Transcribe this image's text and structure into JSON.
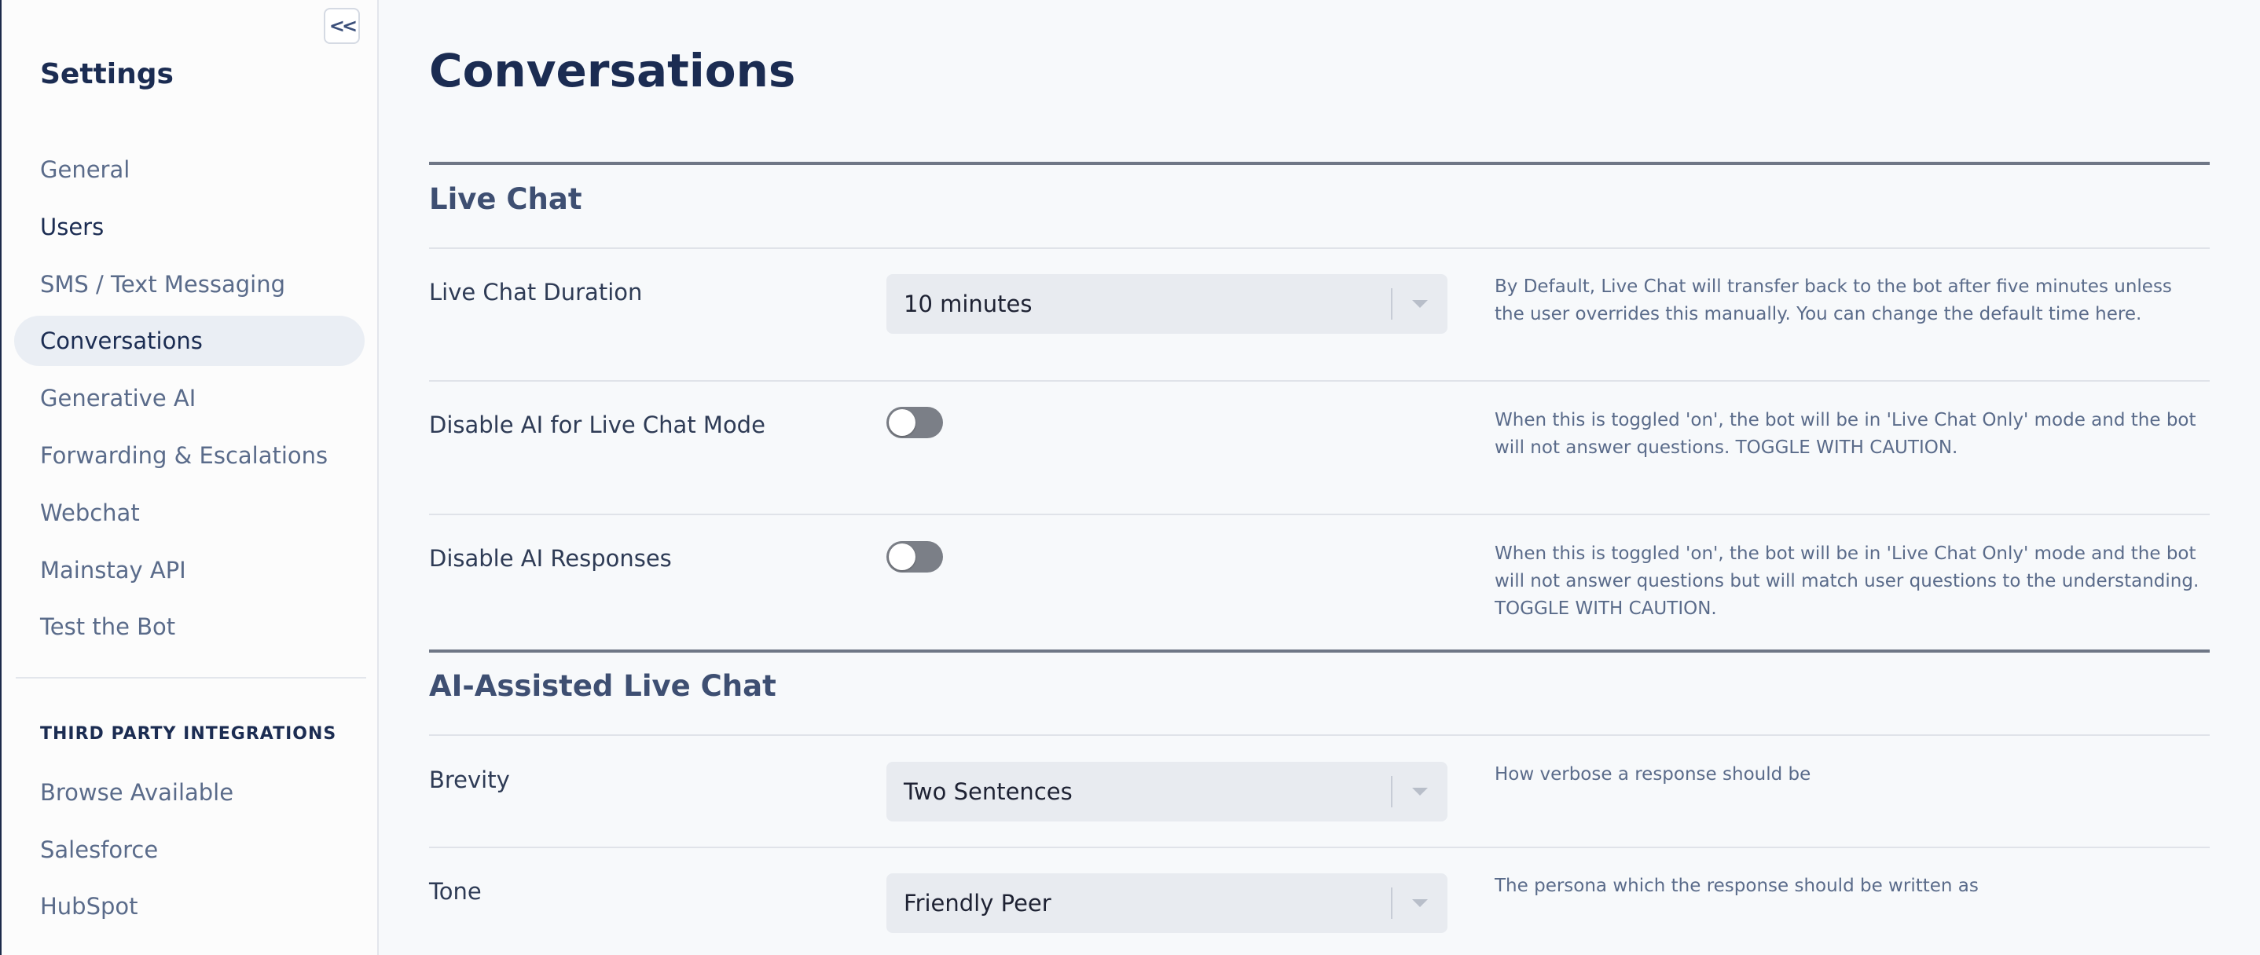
{
  "sidebar": {
    "collapse_label": "<<",
    "title": "Settings",
    "items": [
      {
        "label": "General"
      },
      {
        "label": "Users"
      },
      {
        "label": "SMS / Text Messaging"
      },
      {
        "label": "Conversations"
      },
      {
        "label": "Generative AI"
      },
      {
        "label": "Forwarding & Escalations"
      },
      {
        "label": "Webchat"
      },
      {
        "label": "Mainstay API"
      },
      {
        "label": "Test the Bot"
      }
    ],
    "active_item": "Conversations",
    "integrations_heading": "THIRD PARTY INTEGRATIONS",
    "integrations": [
      {
        "label": "Browse Available"
      },
      {
        "label": "Salesforce"
      },
      {
        "label": "HubSpot"
      }
    ]
  },
  "main": {
    "title": "Conversations",
    "live_chat": {
      "heading": "Live Chat",
      "duration": {
        "label": "Live Chat Duration",
        "value": "10 minutes",
        "help": "By Default, Live Chat will transfer back to the bot after five minutes unless the user overrides this manually. You can change the default time here."
      },
      "disable_ai_mode": {
        "label": "Disable AI for Live Chat Mode",
        "enabled": false,
        "help": "When this is toggled 'on', the bot will be in 'Live Chat Only' mode and the bot will not answer questions. TOGGLE WITH CAUTION."
      },
      "disable_ai_responses": {
        "label": "Disable AI Responses",
        "enabled": false,
        "help": "When this is toggled 'on', the bot will be in 'Live Chat Only' mode and the bot will not answer questions but will match user questions to the understanding. TOGGLE WITH CAUTION."
      }
    },
    "ai_assisted": {
      "heading": "AI-Assisted Live Chat",
      "brevity": {
        "label": "Brevity",
        "value": "Two Sentences",
        "help": "How verbose a response should be"
      },
      "tone": {
        "label": "Tone",
        "value": "Friendly Peer",
        "help": "The persona which the response should be written as"
      }
    }
  },
  "icons": {
    "collapse": "double-chevron-left-icon",
    "select_caret": "caret-down-icon"
  },
  "colors": {
    "heading": "#1b2c52",
    "toggle_off": "#7b7f87",
    "select_bg": "#e8ebf0",
    "active_nav_bg": "#eaeef4"
  }
}
